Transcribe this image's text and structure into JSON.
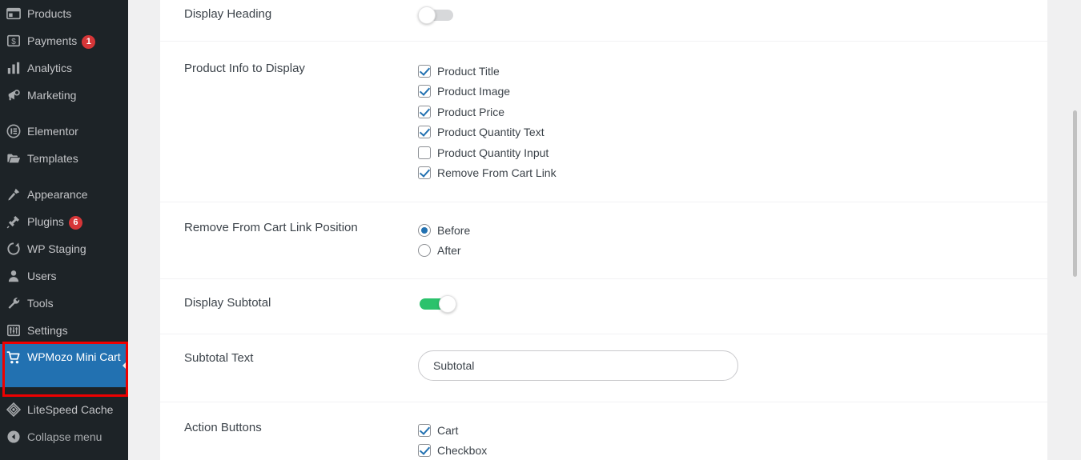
{
  "sidebar": {
    "items": [
      {
        "label": "Products",
        "icon": "products-icon",
        "badge": null,
        "group_start": false,
        "current": false
      },
      {
        "label": "Payments",
        "icon": "payments-icon",
        "badge": "1",
        "group_start": false,
        "current": false
      },
      {
        "label": "Analytics",
        "icon": "analytics-icon",
        "badge": null,
        "group_start": false,
        "current": false
      },
      {
        "label": "Marketing",
        "icon": "marketing-icon",
        "badge": null,
        "group_start": false,
        "current": false
      },
      {
        "label": "Elementor",
        "icon": "elementor-icon",
        "badge": null,
        "group_start": true,
        "current": false
      },
      {
        "label": "Templates",
        "icon": "templates-icon",
        "badge": null,
        "group_start": false,
        "current": false
      },
      {
        "label": "Appearance",
        "icon": "appearance-icon",
        "badge": null,
        "group_start": true,
        "current": false
      },
      {
        "label": "Plugins",
        "icon": "plugins-icon",
        "badge": "6",
        "group_start": false,
        "current": false
      },
      {
        "label": "WP Staging",
        "icon": "wp-staging-icon",
        "badge": null,
        "group_start": false,
        "current": false
      },
      {
        "label": "Users",
        "icon": "users-icon",
        "badge": null,
        "group_start": false,
        "current": false
      },
      {
        "label": "Tools",
        "icon": "tools-icon",
        "badge": null,
        "group_start": false,
        "current": false
      },
      {
        "label": "Settings",
        "icon": "settings-icon",
        "badge": null,
        "group_start": false,
        "current": false
      },
      {
        "label": "WPMozo Mini Cart",
        "icon": "cart-icon",
        "badge": null,
        "group_start": false,
        "current": true
      },
      {
        "label": "LiteSpeed Cache",
        "icon": "litespeed-icon",
        "badge": null,
        "group_start": true,
        "current": false
      },
      {
        "label": "Collapse menu",
        "icon": "collapse-icon",
        "badge": null,
        "group_start": false,
        "current": false
      }
    ],
    "highlight_color": "#ee0000",
    "current_color": "#2271b1",
    "background": "#1d2327"
  },
  "settings": {
    "rows": [
      {
        "id": "display-heading",
        "label": "Display Heading",
        "control": "toggle",
        "value": "off"
      },
      {
        "id": "product-info-to-display",
        "label": "Product Info to Display",
        "control": "checkboxes",
        "options": [
          {
            "label": "Product Title",
            "checked": true
          },
          {
            "label": "Product Image",
            "checked": true
          },
          {
            "label": "Product Price",
            "checked": true
          },
          {
            "label": "Product Quantity Text",
            "checked": true
          },
          {
            "label": "Product Quantity Input",
            "checked": false
          },
          {
            "label": "Remove From Cart Link",
            "checked": true
          }
        ]
      },
      {
        "id": "remove-from-cart-link-position",
        "label": "Remove From Cart Link Position",
        "control": "radios",
        "options": [
          {
            "label": "Before",
            "checked": true
          },
          {
            "label": "After",
            "checked": false
          }
        ]
      },
      {
        "id": "display-subtotal",
        "label": "Display Subtotal",
        "control": "toggle",
        "value": "on"
      },
      {
        "id": "subtotal-text",
        "label": "Subtotal Text",
        "control": "text",
        "value": "Subtotal",
        "placeholder": "Subtotal"
      },
      {
        "id": "action-buttons",
        "label": "Action Buttons",
        "control": "checkboxes",
        "options": [
          {
            "label": "Cart",
            "checked": true
          },
          {
            "label": "Checkbox",
            "checked": true
          }
        ]
      }
    ],
    "toggle_on_color": "#2bc26c",
    "toggle_off_color": "#d7d8da",
    "accent_color": "#2271b1"
  }
}
